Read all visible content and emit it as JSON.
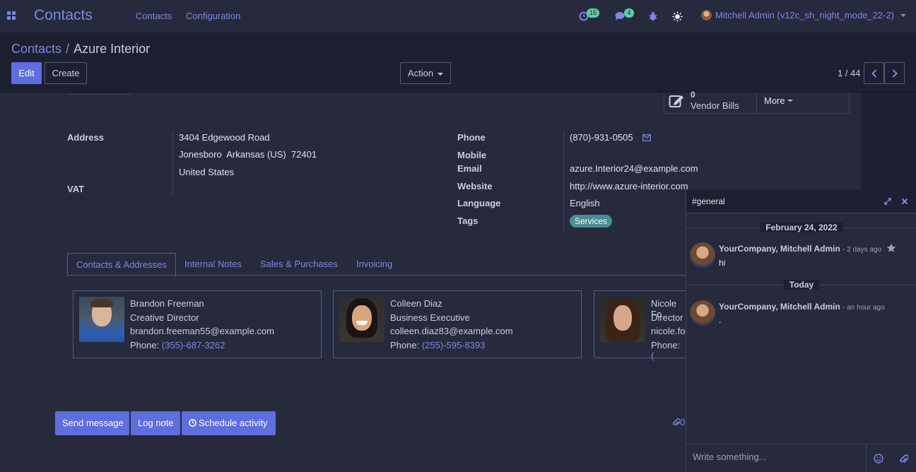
{
  "navbar": {
    "brand": "Contacts",
    "menu": [
      "Contacts",
      "Configuration"
    ],
    "activity_count": "15",
    "message_count": "4",
    "user": "Mitchell Admin (v12c_sh_night_mode_22-2)"
  },
  "control_panel": {
    "breadcrumb_parent": "Contacts",
    "breadcrumb_current": "Azure Interior",
    "edit_label": "Edit",
    "create_label": "Create",
    "action_label": "Action",
    "pager": "1 / 44"
  },
  "smart_buttons": {
    "vendor_bills_count": "0",
    "vendor_bills_label": "Vendor Bills",
    "more_label": "More"
  },
  "form": {
    "address_label": "Address",
    "street": "3404 Edgewood Road",
    "city_line": "Jonesboro  Arkansas (US)  72401",
    "country": "United States",
    "vat_label": "VAT",
    "phone_label": "Phone",
    "phone": "(870)-931-0505",
    "mobile_label": "Mobile",
    "email_label": "Email",
    "email": "azure.Interior24@example.com",
    "website_label": "Website",
    "website": "http://www.azure-interior.com",
    "language_label": "Language",
    "language": "English",
    "tags_label": "Tags",
    "tag": "Services"
  },
  "tabs": [
    "Contacts & Addresses",
    "Internal Notes",
    "Sales & Purchases",
    "Invoicing"
  ],
  "contacts": [
    {
      "name": "Brandon Freeman",
      "title": "Creative Director",
      "email": "brandon.freeman55@example.com",
      "phone_label": "Phone:",
      "phone": "(355)-687-3262"
    },
    {
      "name": "Colleen Diaz",
      "title": "Business Executive",
      "email": "colleen.diaz83@example.com",
      "phone_label": "Phone:",
      "phone": "(255)-595-8393"
    },
    {
      "name": "Nicole Fo",
      "title": "Director",
      "email": "nicole.fo",
      "phone_label": "Phone:",
      "phone": "("
    }
  ],
  "chatter": {
    "send_message": "Send message",
    "log_note": "Log note",
    "schedule_activity": "Schedule activity",
    "attachments": "0"
  },
  "chat": {
    "title": "#general",
    "date1": "February 24, 2022",
    "msg1_author": "YourCompany, Mitchell Admin",
    "msg1_time": "- 2 days ago",
    "msg1_body": "hi",
    "date2": "Today",
    "msg2_author": "YourCompany, Mitchell Admin",
    "msg2_time": "- an hour ago",
    "msg2_body": ".",
    "composer_placeholder": "Write something..."
  },
  "colors": {
    "accent": "#7c87e8",
    "primary_button": "#5f6dde",
    "background": "#262a3c",
    "panel": "#1d2030",
    "tag": "#4a8e96",
    "badge": "#5ad0a8"
  }
}
